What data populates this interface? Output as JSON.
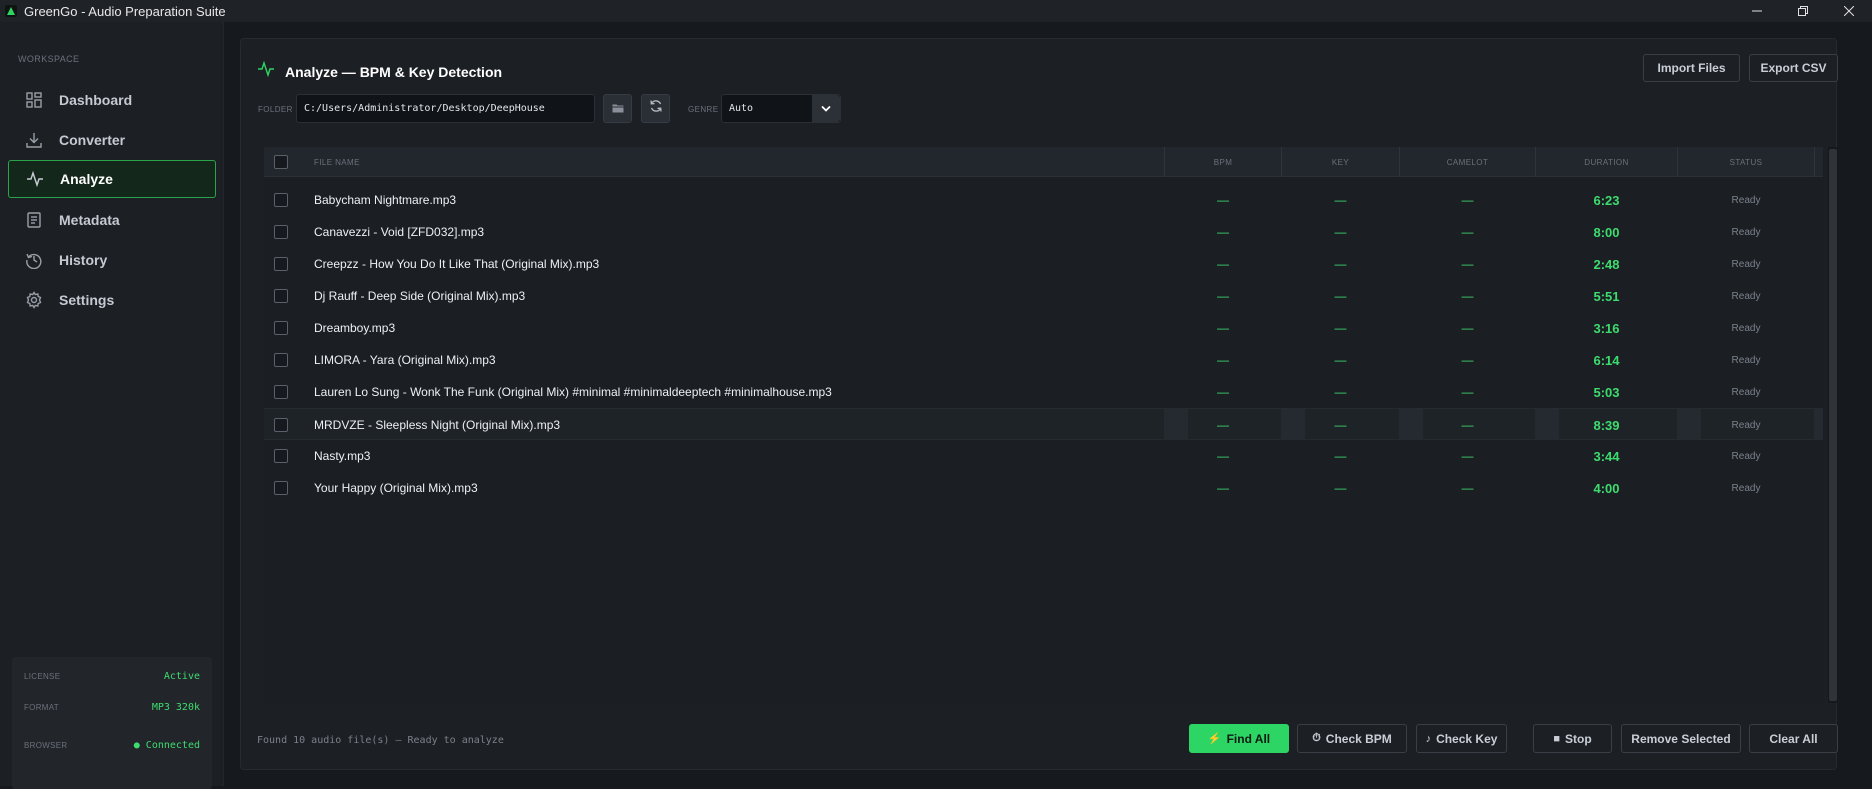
{
  "window": {
    "title": "GreenGo - Audio Preparation Suite",
    "controls": [
      "minimize-icon",
      "restore-icon",
      "close-icon"
    ]
  },
  "sidebar": {
    "section_label": "WORKSPACE",
    "items": [
      {
        "label": "Dashboard",
        "icon": "grid-icon",
        "active": false
      },
      {
        "label": "Converter",
        "icon": "download-icon",
        "active": false
      },
      {
        "label": "Analyze",
        "icon": "pulse-icon",
        "active": true
      },
      {
        "label": "Metadata",
        "icon": "document-icon",
        "active": false
      },
      {
        "label": "History",
        "icon": "history-icon",
        "active": false
      },
      {
        "label": "Settings",
        "icon": "gear-icon",
        "active": false
      }
    ],
    "status": {
      "license_label": "LICENSE",
      "license_value": "Active",
      "format_label": "FORMAT",
      "format_value": "MP3 320k",
      "browser_label": "BROWSER",
      "browser_value": "● Connected"
    }
  },
  "main": {
    "title": "Analyze — BPM & Key Detection",
    "import_label": "Import Files",
    "export_label": "Export CSV",
    "folder_label": "FOLDER",
    "folder_path": "C:/Users/Administrator/Desktop/DeepHouse",
    "genre_label": "GENRE",
    "genre_value": "Auto"
  },
  "table": {
    "columns": [
      "FILE NAME",
      "BPM",
      "KEY",
      "CAMELOT",
      "DURATION",
      "STATUS"
    ],
    "rows": [
      {
        "file": "Babycham Nightmare.mp3",
        "bpm": "—",
        "key": "—",
        "camelot": "—",
        "duration": "6:23",
        "status": "Ready"
      },
      {
        "file": "Canavezzi - Void [ZFD032].mp3",
        "bpm": "—",
        "key": "—",
        "camelot": "—",
        "duration": "8:00",
        "status": "Ready"
      },
      {
        "file": "Creepzz - How You Do It Like That (Original Mix).mp3",
        "bpm": "—",
        "key": "—",
        "camelot": "—",
        "duration": "2:48",
        "status": "Ready"
      },
      {
        "file": "Dj Rauff - Deep Side (Original Mix).mp3",
        "bpm": "—",
        "key": "—",
        "camelot": "—",
        "duration": "5:51",
        "status": "Ready"
      },
      {
        "file": "Dreamboy.mp3",
        "bpm": "—",
        "key": "—",
        "camelot": "—",
        "duration": "3:16",
        "status": "Ready"
      },
      {
        "file": "LIMORA  - Yara (Original Mix).mp3",
        "bpm": "—",
        "key": "—",
        "camelot": "—",
        "duration": "6:14",
        "status": "Ready"
      },
      {
        "file": "Lauren Lo Sung  -  Wonk The Funk  (Original Mix)  #minimal #minimaldeeptech #minimalhouse.mp3",
        "bpm": "—",
        "key": "—",
        "camelot": "—",
        "duration": "5:03",
        "status": "Ready"
      },
      {
        "file": "MRDVZE - Sleepless Night (Original Mix).mp3",
        "bpm": "—",
        "key": "—",
        "camelot": "—",
        "duration": "8:39",
        "status": "Ready"
      },
      {
        "file": "Nasty.mp3",
        "bpm": "—",
        "key": "—",
        "camelot": "—",
        "duration": "3:44",
        "status": "Ready"
      },
      {
        "file": "Your Happy (Original Mix).mp3",
        "bpm": "—",
        "key": "—",
        "camelot": "—",
        "duration": "4:00",
        "status": "Ready"
      }
    ]
  },
  "footer": {
    "status_text": "Found 10 audio file(s) — Ready to analyze",
    "find_all": "Find All",
    "check_bpm": "Check BPM",
    "check_key": "Check Key",
    "stop": "Stop",
    "remove_selected": "Remove Selected",
    "clear_all": "Clear All"
  },
  "colors": {
    "accent": "#2dd664",
    "background": "#16191e",
    "panel": "#1c2025",
    "active_nav_bg": "#13281a"
  }
}
